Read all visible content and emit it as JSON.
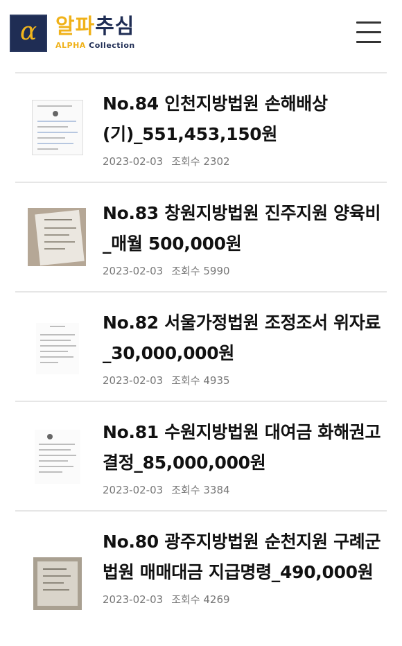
{
  "brand": {
    "symbol": "α",
    "title_part1": "알파",
    "title_part2": "추심",
    "subtitle_part1": "ALPHA",
    "subtitle_part2": " Collection"
  },
  "posts": [
    {
      "title": "No.84 인천지방법원 손해배상(기)_551,453,150원",
      "date": "2023-02-03",
      "views": "조회수 2302",
      "thumb_icon": "court-document-thumbnail"
    },
    {
      "title": "No.83 창원지방법원 진주지원 양육비_매월 500,000원",
      "date": "2023-02-03",
      "views": "조회수 5990",
      "thumb_icon": "court-document-photo-thumbnail"
    },
    {
      "title": "No.82 서울가정법원 조정조서 위자료_30,000,000원",
      "date": "2023-02-03",
      "views": "조회수 4935",
      "thumb_icon": "court-document-thumbnail"
    },
    {
      "title": "No.81 수원지방법원 대여금 화해권고결정_85,000,000원",
      "date": "2023-02-03",
      "views": "조회수 3384",
      "thumb_icon": "court-document-thumbnail"
    },
    {
      "title": "No.80 광주지방법원 순천지원 구례군법원 매매대금 지급명령_490,000원",
      "date": "2023-02-03",
      "views": "조회수 4269",
      "thumb_icon": "court-document-photo-thumbnail"
    }
  ]
}
